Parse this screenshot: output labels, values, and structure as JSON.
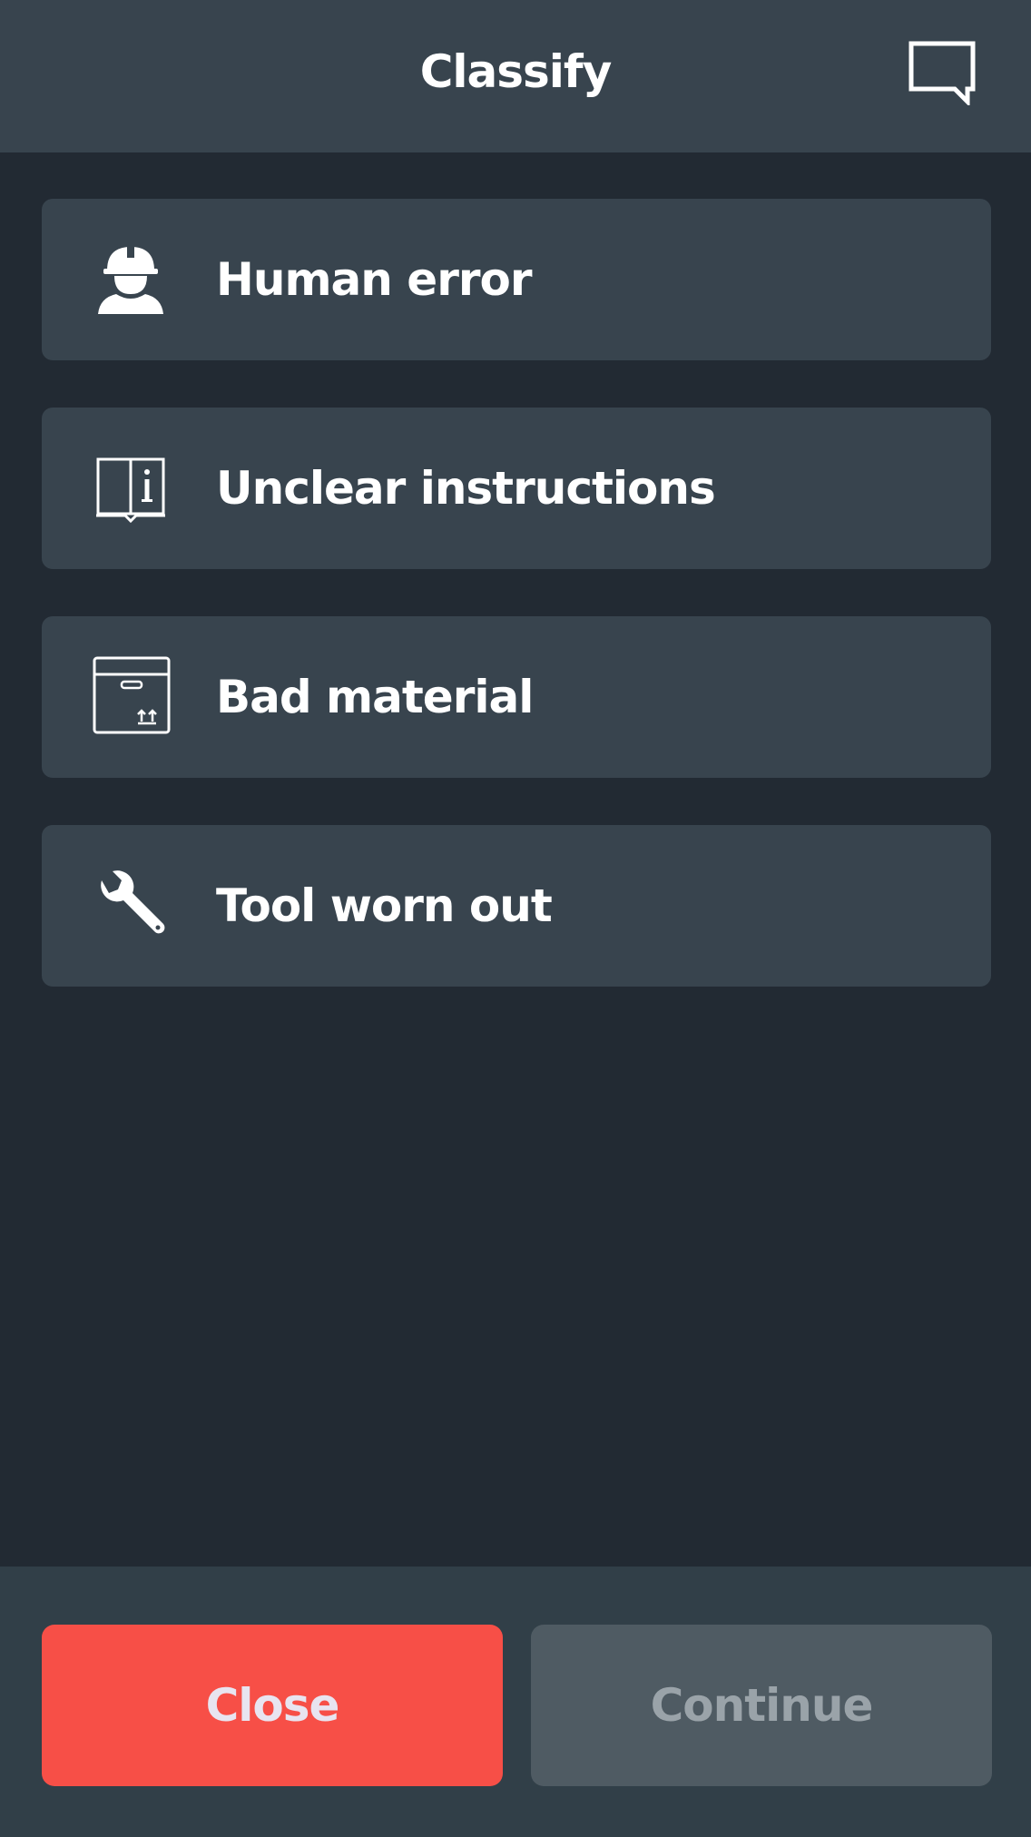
{
  "header": {
    "title": "Classify",
    "comment_icon": "speech-bubble-icon"
  },
  "reasons": [
    {
      "label": "Human error",
      "icon": "worker-helmet-icon"
    },
    {
      "label": "Unclear instructions",
      "icon": "manual-book-icon"
    },
    {
      "label": "Bad material",
      "icon": "package-box-icon"
    },
    {
      "label": "Tool worn out",
      "icon": "wrench-icon"
    }
  ],
  "footer": {
    "close_label": "Close",
    "continue_label": "Continue"
  },
  "colors": {
    "header_bg": "#38444e",
    "page_bg": "#222a33",
    "card_bg": "#38444e",
    "footer_bg": "#313f48",
    "close_bg": "#f74f47",
    "continue_bg": "#4f5b63"
  }
}
